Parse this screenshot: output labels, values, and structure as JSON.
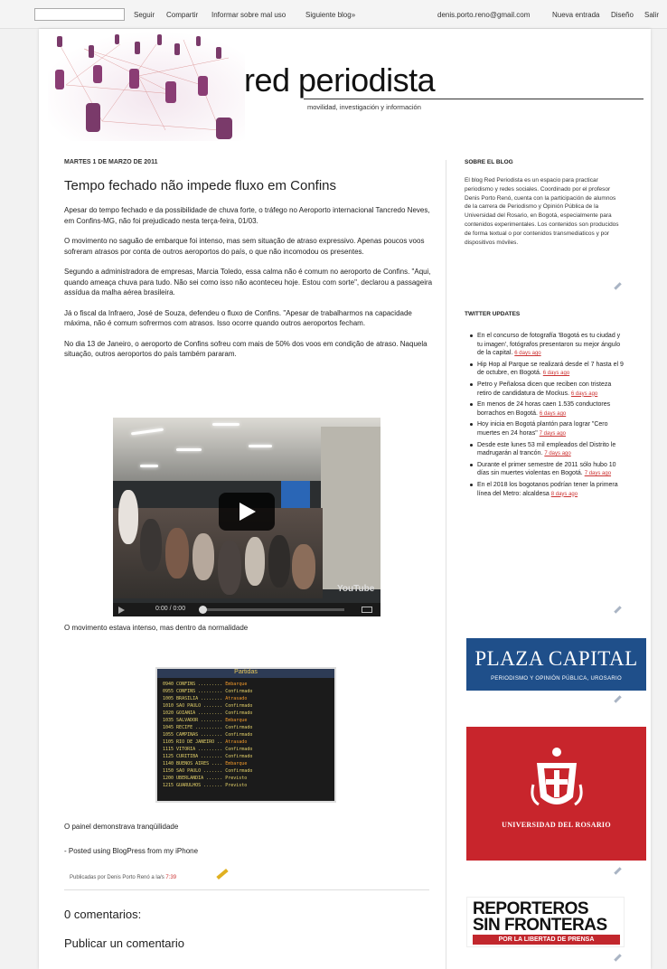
{
  "navbar": {
    "follow": "Seguir",
    "share": "Compartir",
    "report": "Informar sobre mal uso",
    "next_blog": "Siguiente blog»",
    "email": "denis.porto.reno@gmail.com",
    "new_post": "Nueva entrada",
    "design": "Diseño",
    "exit": "Salir"
  },
  "header": {
    "title": "red periodista",
    "subtitle": "movilidad, investigación y información"
  },
  "post": {
    "date": "MARTES 1 DE MARZO DE 2011",
    "title": "Tempo fechado não impede fluxo em Confins",
    "paragraphs": [
      "Apesar do tempo fechado e da possibilidade de chuva forte, o tráfego no Aeroporto internacional Tancredo Neves, em Confins-MG, não foi prejudicado nesta terça-feira, 01/03.",
      "O movimento no saguão de embarque foi intenso, mas sem situação de atraso expressivo. Apenas poucos voos sofreram atrasos por conta de outros aeroportos do país, o que não incomodou os presentes.",
      "Segundo a administradora de empresas, Marcia Toledo, essa calma não é comum no aeroporto de Confins. \"Aqui, quando ameaça chuva para tudo. Não sei como isso não aconteceu hoje. Estou com sorte\", declarou a passageira assídua da malha aérea brasileira.",
      "Já o fiscal da Infraero, José de Souza, defendeu o fluxo de Confins. \"Apesar de trabalharmos na capacidade máxima, não é comum sofrermos com atrasos. Isso ocorre quando outros aeroportos fecham.",
      "No dia 13 de Janeiro, o aeroporto de Confins sofreu com mais de 50% dos voos em condição de atraso. Naquela situação, outros aeroportos do país também pararam."
    ],
    "video": {
      "time": "0:00 / 0:00",
      "brand": "YouTube"
    },
    "caption1": "O movimento estava intenso, mas dentro da normalidade",
    "board_title": "Partidas",
    "caption2": "O painel demonstrava tranqüilidade",
    "posted_using": "- Posted using BlogPress from my iPhone",
    "footer_text": "Publicadas por Denis Porto Renó a la/s",
    "footer_time": "7:39",
    "comments": "0 comentarios:",
    "publish": "Publicar un comentario"
  },
  "sidebar": {
    "about_heading": "SOBRE EL BLOG",
    "about_text": "El blog Red Periodista es un espacio para practicar periodismo y redes sociales. Coordinado por el profesor Denis Porto Renó, cuenta con la participación de alumnos de la carrera de Periodismo y Opinión Pública de la Universidad del Rosario, en Bogotá, especialmente para contenidos experimentales. Los contenidos son producidos de forma textual o por contenidos transmediaticos y por dispositivos móviles.",
    "twitter_heading": "TWITTER UPDATES",
    "tweets": [
      {
        "text": "En el concurso de fotografía 'Bogotá es tu ciudad y tu imagen', fotógrafos presentaron su mejor ángulo de la capital.",
        "ago": "6 days ago"
      },
      {
        "text": "Hip Hop al Parque se realizará desde el 7 hasta el 9 de octubre, en Bogotá.",
        "ago": "6 days ago"
      },
      {
        "text": "Petro y Peñalosa dicen que reciben con tristeza retiro de candidatura de Mockus.",
        "ago": "6 days ago"
      },
      {
        "text": "En menos de 24 horas caen 1.535 conductores borrachos en Bogotá.",
        "ago": "6 days ago"
      },
      {
        "text": "Hoy inicia en Bogotá plantón para lograr \"Cero muertes en 24 horas\"",
        "ago": "7 days ago"
      },
      {
        "text": "Desde este lunes 53 mil empleados del Distrito le madrugarán al trancón.",
        "ago": "7 days ago"
      },
      {
        "text": "Durante el primer semestre de 2011 sólo hubo 10 días sin muertes violentas en Bogotá.",
        "ago": "7 days ago"
      },
      {
        "text": "En el 2018 los bogotanos podrían tener la primera línea del Metro: alcaldesa",
        "ago": "8 days ago"
      }
    ],
    "plaza_title": "PLAZA CAPITAL",
    "plaza_sub": "PERIODISMO Y OPINIÓN PÚBLICA, UROSARIO",
    "rosario_text": "UNIVERSIDAD DEL ROSARIO",
    "rsf_line1": "REPORTEROS",
    "rsf_line2": "SIN FRONTERAS",
    "rsf_line3": "POR LA LIBERTAD DE PRENSA"
  },
  "colors": {
    "link_red": "#cc3333",
    "plaza_blue": "#1f4f8a",
    "rosario_red": "#c8252c",
    "logo_purple": "#7a3a6a"
  }
}
